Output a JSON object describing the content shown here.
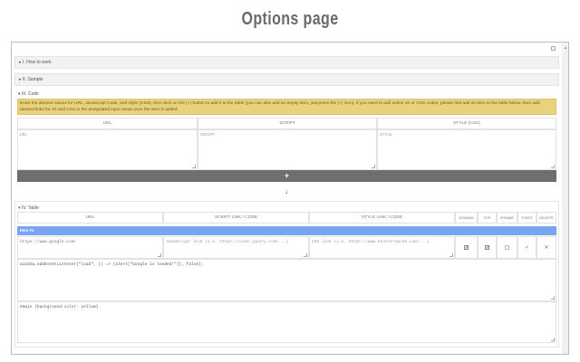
{
  "page_title": "Options page",
  "sections": {
    "how_to_work": "I. How to work",
    "sample": "II. Sample",
    "code": "III. Code",
    "table": "IV. Table"
  },
  "notice": "Enter the desired values for URL, JavaScript Code, and Style (CSS), then click on the (+) button to add it to the table (you can also add an empty item, just press the (+) icon). If you need to add online JS or CSS codes, please first add an item to the table below, then add desired links for JS and CSS in the designated input areas once the item is added.",
  "code_form": {
    "headers": [
      "URL",
      "SCRIPT",
      "STYLE (CSS)"
    ],
    "placeholders": {
      "url": "URL",
      "script": "SCRIPT",
      "style": "STYLE"
    },
    "add_label": "+"
  },
  "arrow": "↓",
  "table": {
    "headers": [
      "URL",
      "SCRIPT LINK / CODE",
      "STYLE LINK / CODE",
      "DOMAIN",
      "TOP",
      "IFRAME",
      "STATE",
      "DELETE"
    ],
    "items": [
      {
        "label": "Item #1",
        "url": "https://www.google.com/",
        "script_link_placeholder": "JavaScript link (i.e. https://code.jquery.com/...)",
        "style_link_placeholder": "CSS link (i.e. https://www.bootstrapcdn.com/...)",
        "domain": true,
        "top": true,
        "iframe": false,
        "state_icon": "✓",
        "delete_icon": "✕",
        "script": "window.addEventListener(\"load\", () => {alert(\"Google is loaded!\")}, false);",
        "style": "#main {background-color: yellow}"
      }
    ]
  },
  "colors": {
    "item_bar": "#79a4ef",
    "notice": "#ead27c",
    "add_bar": "#6e6e6e"
  }
}
